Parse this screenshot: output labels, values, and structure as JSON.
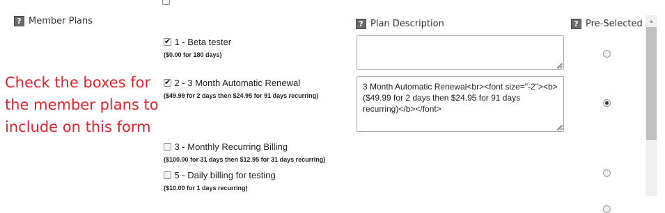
{
  "headers": {
    "member_plans": "Member Plans",
    "plan_description": "Plan Description",
    "pre_selected": "Pre-Selected",
    "help_glyph": "?"
  },
  "annotation": {
    "lines": [
      "Check the boxes for",
      "the member plans to",
      "include on this form"
    ],
    "color": "#e8222b"
  },
  "plans": [
    {
      "label": "1 - Beta tester",
      "price": "($0.00 for 180 days)",
      "checked": true,
      "description": "",
      "preselected": false
    },
    {
      "label": "2 - 3 Month Automatic Renewal",
      "price": "($49.99 for 2 days then $24.95 for 91 days recurring)",
      "checked": true,
      "description": "3 Month Automatic Renewal<br><font size=\"-2\"><b>($49.99 for 2 days then $24.95 for 91 days recurring)</b></font>",
      "preselected": true
    },
    {
      "label": "3 - Monthly Recurring Billing",
      "price": "($100.00 for 31 days then $12.95 for 31 days recurring)",
      "checked": false,
      "preselected": false
    },
    {
      "label": "5 - Daily billing for testing",
      "price": "($10.00 for 1 days recurring)",
      "checked": false,
      "preselected": false
    }
  ],
  "scrollbar": {
    "up_arrow": "▲"
  }
}
